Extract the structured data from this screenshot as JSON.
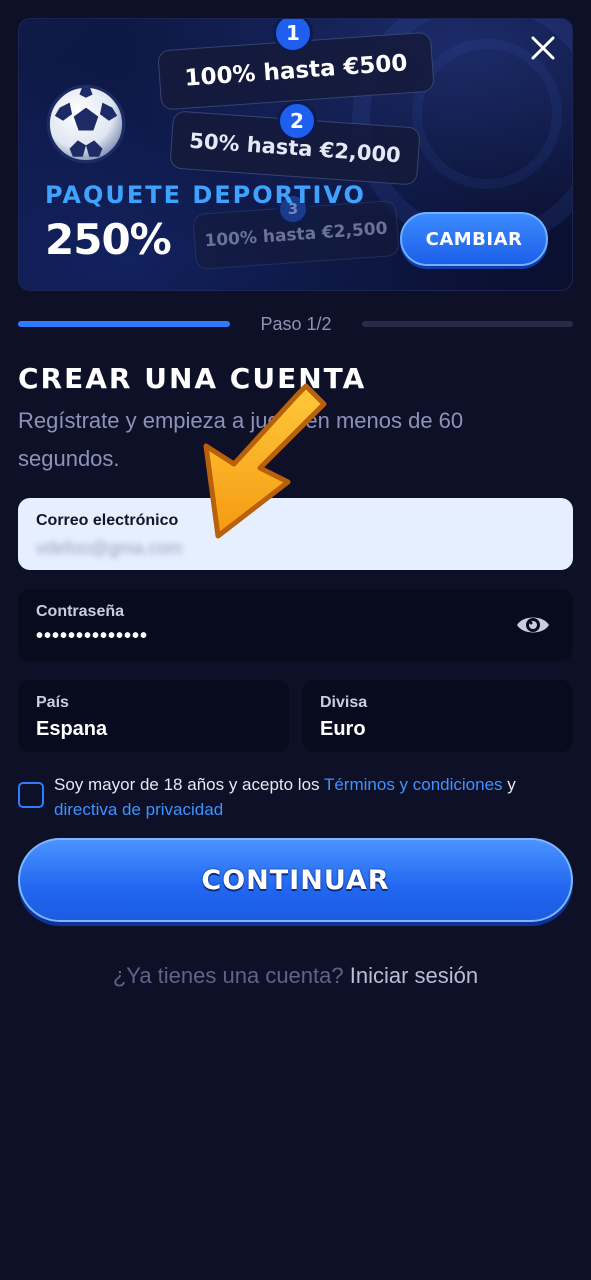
{
  "banner": {
    "tiers": [
      {
        "number": "1",
        "label": "100% hasta €500"
      },
      {
        "number": "2",
        "label": "50% hasta €2,000"
      },
      {
        "number": "3",
        "label": "100% hasta €2,500"
      }
    ],
    "package_title": "PAQUETE DEPORTIVO",
    "package_percent": "250%",
    "change_button": "CAMBIAR"
  },
  "progress": {
    "step_label": "Paso 1/2",
    "fraction": 0.5
  },
  "form": {
    "title": "CREAR UNA CUENTA",
    "subtitle": "Regístrate y empieza a jugar en menos de 60 segundos.",
    "email": {
      "label": "Correo electrónico",
      "value": "vdefoo@gma.com"
    },
    "password": {
      "label": "Contraseña",
      "value": "••••••••••••••"
    },
    "country": {
      "label": "País",
      "value": "Espana"
    },
    "currency": {
      "label": "Divisa",
      "value": "Euro"
    },
    "terms": {
      "prefix": "Soy mayor de 18 años y acepto los ",
      "terms_link": "Términos y condiciones",
      "middle": " y ",
      "privacy_link": "directiva de privacidad",
      "checked": false
    },
    "continue_button": "CONTINUAR",
    "login_prompt": "¿Ya tienes una cuenta? ",
    "login_link": "Iniciar sesión"
  },
  "colors": {
    "background": "#0d1027",
    "accent": "#2f7bff",
    "link": "#3f92ff",
    "arrow": "#f7a21a"
  },
  "icons": [
    "close-icon",
    "soccer-ball-icon",
    "eye-icon",
    "arrow-pointer-icon"
  ]
}
